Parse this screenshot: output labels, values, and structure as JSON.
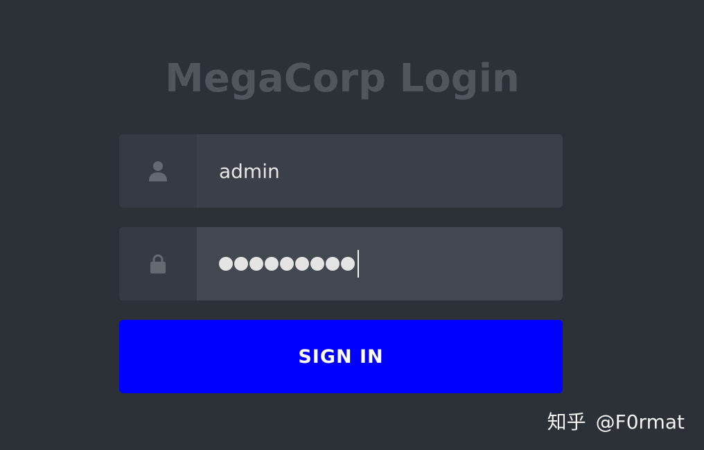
{
  "page": {
    "title": "MegaCorp Login"
  },
  "form": {
    "username": {
      "value": "admin",
      "icon": "user-icon"
    },
    "password": {
      "masked_length": 9,
      "icon": "lock-icon"
    },
    "submit_label": "SIGN IN"
  },
  "watermark": {
    "site": "知乎",
    "author": "@F0rmat"
  },
  "colors": {
    "background": "#2c3138",
    "accent": "#0000ff",
    "title": "#51565d"
  }
}
